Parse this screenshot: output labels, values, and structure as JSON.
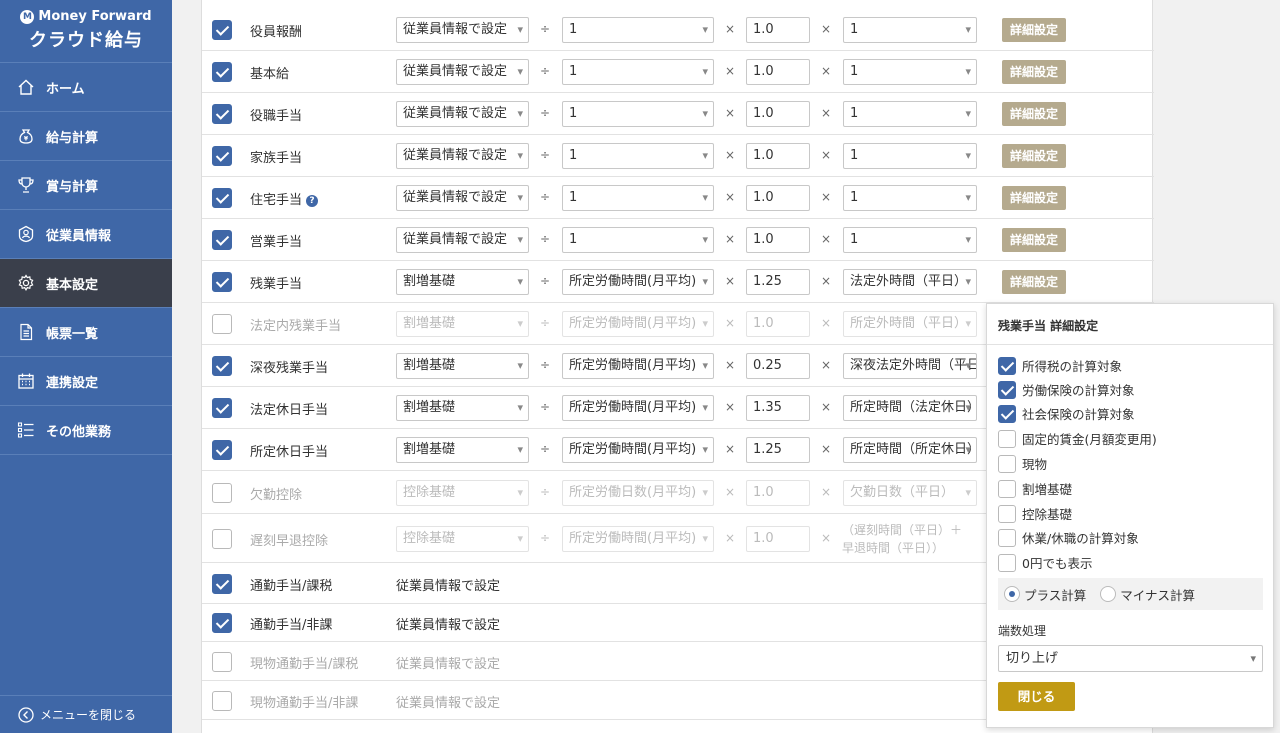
{
  "sidebar": {
    "brand": "Money Forward",
    "product": "クラウド給与",
    "items": [
      {
        "label": "ホーム",
        "icon": "home-icon"
      },
      {
        "label": "給与計算",
        "icon": "money-bag-icon"
      },
      {
        "label": "賞与計算",
        "icon": "trophy-icon"
      },
      {
        "label": "従業員情報",
        "icon": "employee-icon"
      },
      {
        "label": "基本設定",
        "icon": "gear-icon"
      },
      {
        "label": "帳票一覧",
        "icon": "document-icon"
      },
      {
        "label": "連携設定",
        "icon": "calendar-icon"
      },
      {
        "label": "その他業務",
        "icon": "list-icon"
      }
    ],
    "active_index": 4,
    "collapse_label": "メニューを閉じる"
  },
  "table": {
    "div_symbol": "÷",
    "mul_symbol": "×",
    "detail_label": "詳細設定",
    "rows": [
      {
        "name": "役員報酬",
        "checked": true,
        "disabled": false,
        "base": "従業員情報で設定",
        "divisor": "1",
        "rate": "1.0",
        "factor": "1",
        "detail": true
      },
      {
        "name": "基本給",
        "checked": true,
        "disabled": false,
        "base": "従業員情報で設定",
        "divisor": "1",
        "rate": "1.0",
        "factor": "1",
        "detail": true
      },
      {
        "name": "役職手当",
        "checked": true,
        "disabled": false,
        "base": "従業員情報で設定",
        "divisor": "1",
        "rate": "1.0",
        "factor": "1",
        "detail": true
      },
      {
        "name": "家族手当",
        "checked": true,
        "disabled": false,
        "base": "従業員情報で設定",
        "divisor": "1",
        "rate": "1.0",
        "factor": "1",
        "detail": true
      },
      {
        "name": "住宅手当",
        "checked": true,
        "disabled": false,
        "base": "従業員情報で設定",
        "divisor": "1",
        "rate": "1.0",
        "factor": "1",
        "detail": true,
        "help": true
      },
      {
        "name": "営業手当",
        "checked": true,
        "disabled": false,
        "base": "従業員情報で設定",
        "divisor": "1",
        "rate": "1.0",
        "factor": "1",
        "detail": true
      },
      {
        "name": "残業手当",
        "checked": true,
        "disabled": false,
        "base": "割増基礎",
        "divisor": "所定労働時間(月平均)",
        "rate": "1.25",
        "factor": "法定外時間（平日）",
        "detail": true
      },
      {
        "name": "法定内残業手当",
        "checked": false,
        "disabled": true,
        "base": "割増基礎",
        "divisor": "所定労働時間(月平均)",
        "rate": "1.0",
        "factor": "所定外時間（平日）",
        "detail": false
      },
      {
        "name": "深夜残業手当",
        "checked": true,
        "disabled": false,
        "base": "割増基礎",
        "divisor": "所定労働時間(月平均)",
        "rate": "0.25",
        "factor": "深夜法定外時間（平日）",
        "detail": false
      },
      {
        "name": "法定休日手当",
        "checked": true,
        "disabled": false,
        "base": "割増基礎",
        "divisor": "所定労働時間(月平均)",
        "rate": "1.35",
        "factor": "所定時間（法定休日）",
        "detail": false
      },
      {
        "name": "所定休日手当",
        "checked": true,
        "disabled": false,
        "base": "割増基礎",
        "divisor": "所定労働時間(月平均)",
        "rate": "1.25",
        "factor": "所定時間（所定休日）",
        "detail": false
      },
      {
        "name": "欠勤控除",
        "checked": false,
        "disabled": true,
        "base": "控除基礎",
        "divisor": "所定労働日数(月平均)",
        "rate": "1.0",
        "factor": "欠勤日数（平日）",
        "detail": false
      },
      {
        "name": "遅刻早退控除",
        "checked": false,
        "disabled": true,
        "base": "控除基礎",
        "divisor": "所定労働時間(月平均)",
        "rate": "1.0",
        "factor_line1": "（遅刻時間（平日）＋",
        "factor_line2": "早退時間（平日））",
        "detail": false
      },
      {
        "name": "通勤手当/課税",
        "checked": true,
        "disabled": false,
        "plain": "従業員情報で設定"
      },
      {
        "name": "通勤手当/非課",
        "checked": true,
        "disabled": false,
        "plain": "従業員情報で設定"
      },
      {
        "name": "現物通勤手当/課税",
        "checked": false,
        "disabled": true,
        "plain": "従業員情報で設定"
      },
      {
        "name": "現物通勤手当/非課",
        "checked": false,
        "disabled": true,
        "plain": "従業員情報で設定"
      }
    ]
  },
  "popover": {
    "title": "残業手当 詳細設定",
    "options": [
      {
        "label": "所得税の計算対象",
        "checked": true
      },
      {
        "label": "労働保険の計算対象",
        "checked": true
      },
      {
        "label": "社会保険の計算対象",
        "checked": true
      },
      {
        "label": "固定的賃金(月額変更用)",
        "checked": false
      },
      {
        "label": "現物",
        "checked": false
      },
      {
        "label": "割増基礎",
        "checked": false
      },
      {
        "label": "控除基礎",
        "checked": false
      },
      {
        "label": "休業/休職の計算対象",
        "checked": false
      },
      {
        "label": "0円でも表示",
        "checked": false
      }
    ],
    "radio_plus": "プラス計算",
    "radio_minus": "マイナス計算",
    "radio_selected": "plus",
    "rounding_label": "端数処理",
    "rounding_value": "切り上げ",
    "close_label": "閉じる"
  },
  "colors": {
    "sidebar": "#3f67a7",
    "active": "#3a3f4b",
    "detail_button": "#b5aa8e",
    "close_button": "#c19a14"
  }
}
